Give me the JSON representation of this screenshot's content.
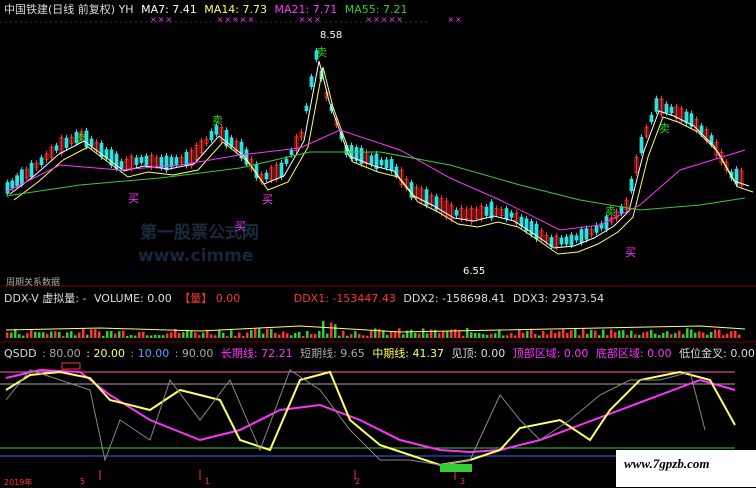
{
  "colors": {
    "ma7": "#ffffff",
    "ma14": "#ffff66",
    "ma21": "#ff33ff",
    "ma55": "#33cc33",
    "up": "#ff3333",
    "down": "#33e0e0",
    "grid": "#7a0000",
    "text": "#cccccc",
    "buy": "#ff33ff",
    "sell": "#33cc33"
  },
  "price_panel": {
    "title": "中国铁建(日线 前复权) YH",
    "ma7_label": "MA7: 7.41",
    "ma14_label": "MA14: 7.73",
    "ma21_label": "MA21: 7.71",
    "ma55_label": "MA55: 7.21",
    "high_label": "8.58",
    "low_label": "6.55",
    "buy_label": "买",
    "sell_label": "卖",
    "marks": "××× ××××× ××× ××××× ××"
  },
  "separator_label": "周期关系数据",
  "ddx_panel": {
    "name": "DDX-V 虚拟量: -",
    "volume_label": "VOLUME: 0.00",
    "vol_tag": "【量】",
    "vol_value": "0.00",
    "ddx1": "DDX1: -153447.43",
    "ddx2": "DDX2: -158698.41",
    "ddx3": "DDX3: 29373.54",
    "tick_label": "买"
  },
  "qsdd_panel": {
    "name": "QSDD",
    "level_80": ": 80.00",
    "level_20": ": 20.00",
    "level_10": ": 10.00",
    "level_90": ": 90.00",
    "long_label": "长期线: 72.21",
    "short_label": "短期线: 9.65",
    "mid_label": "中期线: 41.37",
    "top_label": "见顶: 0.00",
    "top_zone": "顶部区域: 0.00",
    "bottom_zone": "底部区域: 0.00",
    "low_cross": "低位金叉: 0.00"
  },
  "watermark": {
    "line1": "第一股票公式网",
    "line2": "www.cimme",
    "site": "www.7gpzb.com"
  },
  "date_labels": [
    "2019年",
    "5",
    "1",
    "2",
    "3"
  ]
}
